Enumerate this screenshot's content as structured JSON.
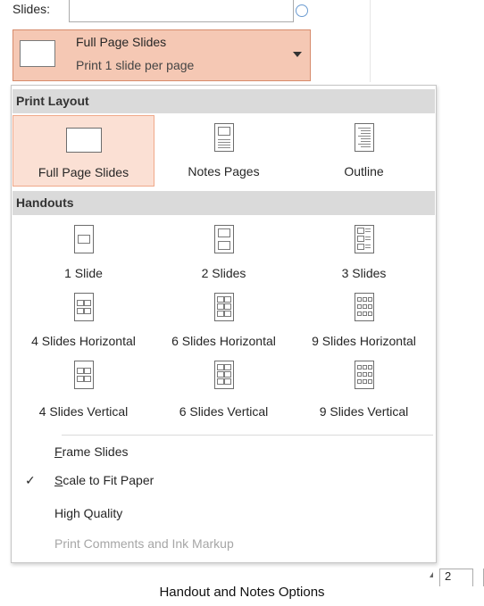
{
  "backdrop": {
    "slides_label": "Slides:"
  },
  "selector": {
    "title": "Full Page Slides",
    "subtitle": "Print 1 slide per page"
  },
  "print_layout": {
    "header": "Print Layout",
    "items": [
      {
        "label": "Full Page Slides",
        "icon": "full-page-slide-icon",
        "selected": true
      },
      {
        "label": "Notes Pages",
        "icon": "notes-pages-icon",
        "selected": false
      },
      {
        "label": "Outline",
        "icon": "outline-icon",
        "selected": false
      }
    ]
  },
  "handouts": {
    "header": "Handouts",
    "items": [
      {
        "label": "1 Slide",
        "icon": "handout-1-slide-icon"
      },
      {
        "label": "2 Slides",
        "icon": "handout-2-slides-icon"
      },
      {
        "label": "3 Slides",
        "icon": "handout-3-slides-icon"
      },
      {
        "label": "4 Slides Horizontal",
        "icon": "handout-4-horizontal-icon"
      },
      {
        "label": "6 Slides Horizontal",
        "icon": "handout-6-horizontal-icon"
      },
      {
        "label": "9 Slides Horizontal",
        "icon": "handout-9-horizontal-icon"
      },
      {
        "label": "4 Slides Vertical",
        "icon": "handout-4-vertical-icon"
      },
      {
        "label": "6 Slides Vertical",
        "icon": "handout-6-vertical-icon"
      },
      {
        "label": "9 Slides Vertical",
        "icon": "handout-9-vertical-icon"
      }
    ]
  },
  "options": [
    {
      "key": "F",
      "rest": "rame Slides",
      "checked": false,
      "enabled": true
    },
    {
      "key": "S",
      "rest": "cale to Fit Paper",
      "checked": true,
      "enabled": true
    },
    {
      "key": "",
      "rest": "High Quality",
      "checked": false,
      "enabled": true
    },
    {
      "key": "",
      "rest": "Print Comments and Ink Markup",
      "checked": false,
      "enabled": false
    }
  ],
  "check_glyph": "✓",
  "pager": {
    "value": "2"
  },
  "caption": "Handout and Notes Options",
  "colors": {
    "selected_bg": "#f5c8b4",
    "selected_border": "#d68b6b",
    "section_bg": "#dadada"
  }
}
